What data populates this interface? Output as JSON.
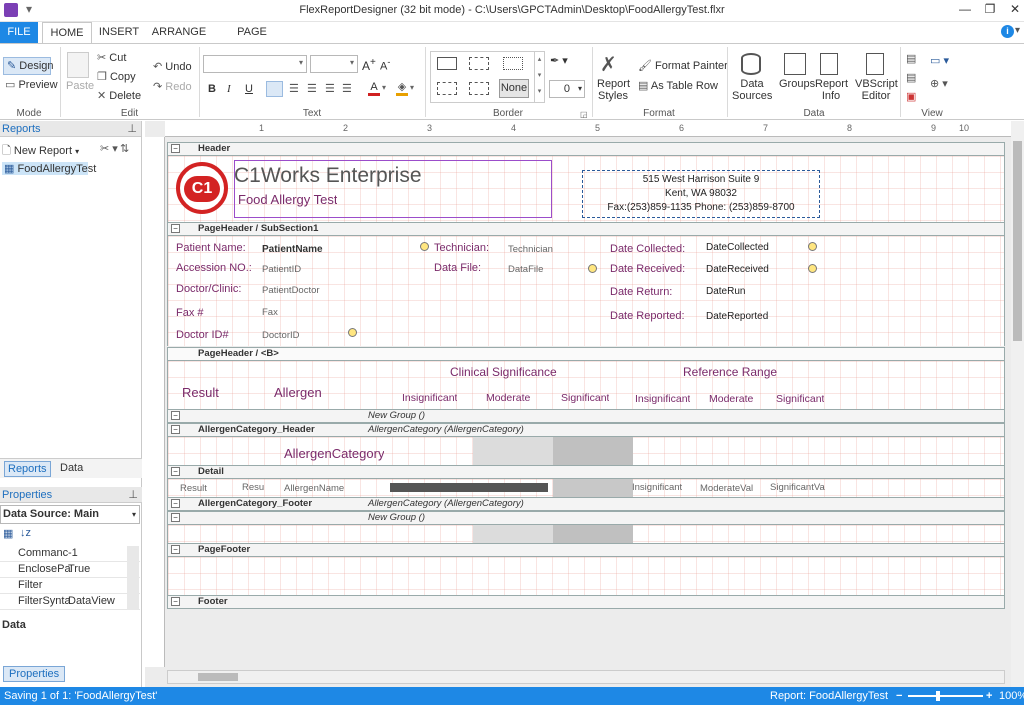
{
  "window": {
    "title": "FlexReportDesigner (32 bit mode) - C:\\Users\\GPCTAdmin\\Desktop\\FoodAllergyTest.flxr"
  },
  "tabs": [
    "FILE",
    "HOME",
    "INSERT",
    "ARRANGE",
    "PAGE SETUP"
  ],
  "ribbon": {
    "mode": {
      "design": "Design",
      "preview": "Preview",
      "label": "Mode"
    },
    "edit": {
      "paste": "Paste",
      "cut": "Cut",
      "copy": "Copy",
      "delete": "Delete",
      "undo": "Undo",
      "redo": "Redo",
      "label": "Edit"
    },
    "text": {
      "label": "Text"
    },
    "border": {
      "none": "None",
      "width": "0",
      "label": "Border"
    },
    "format": {
      "report_styles": "Report\nStyles",
      "format_painter": "Format Painter",
      "as_table_row": "As Table Row",
      "label": "Format"
    },
    "data": {
      "data_sources": "Data\nSources",
      "groups": "Groups",
      "report_info": "Report\nInfo",
      "vbscript": "VBScript\nEditor",
      "label": "Data"
    },
    "view": {
      "label": "View"
    }
  },
  "left": {
    "reports_title": "Reports",
    "new_report": "New Report",
    "report_item": "FoodAllergyTest",
    "tab_reports": "Reports",
    "tab_data": "Data",
    "properties_title": "Properties",
    "datasource": "Data Source: Main",
    "props": [
      {
        "k": "Commanc",
        "v": "-1"
      },
      {
        "k": "EnclosePa",
        "v": "True"
      },
      {
        "k": "Filter",
        "v": ""
      },
      {
        "k": "FilterSynta",
        "v": "DataView"
      }
    ],
    "desc": "Data",
    "tab_properties": "Properties"
  },
  "ruler": [
    "1",
    "2",
    "3",
    "4",
    "5",
    "6",
    "7",
    "8",
    "9",
    "10"
  ],
  "bands": {
    "header": "Header",
    "pageheader1": "PageHeader / SubSection1",
    "pageheader2": "PageHeader / <B>",
    "newgroup1": "New Group ()",
    "cat_header": "AllergenCategory_Header",
    "cat_header_sub": "AllergenCategory (AllergenCategory)",
    "detail": "Detail",
    "cat_footer": "AllergenCategory_Footer",
    "cat_footer_sub": "AllergenCategory (AllergenCategory)",
    "newgroup2": "New Group ()",
    "pagefooter": "PageFooter",
    "footer": "Footer"
  },
  "header": {
    "logo": "C1",
    "company": "C1Works Enterprise",
    "subtitle": "Food Allergy Test",
    "addr1": "515 West Harrison Suite 9",
    "addr2": "Kent, WA 98032",
    "addr3": "Fax:(253)859-1135 Phone: (253)859-8700"
  },
  "ph1": {
    "patient_name_lbl": "Patient Name:",
    "patient_name_fld": "PatientName",
    "accession_lbl": "Accession NO.:",
    "accession_fld": "PatientID",
    "doctor_lbl": "Doctor/Clinic:",
    "doctor_fld": "PatientDoctor",
    "fax_lbl": "Fax #",
    "fax_fld": "Fax",
    "doctorid_lbl": "Doctor ID#",
    "doctorid_fld": "DoctorID",
    "tech_lbl": "Technician:",
    "tech_fld": "Technician",
    "datafile_lbl": "Data File:",
    "datafile_fld": "DataFile",
    "collected_lbl": "Date Collected:",
    "collected_fld": "DateCollected",
    "received_lbl": "Date Received:",
    "received_fld": "DateReceived",
    "return_lbl": "Date Return:",
    "return_fld": "DateRun",
    "reported_lbl": "Date Reported:",
    "reported_fld": "DateReported"
  },
  "ph2": {
    "result": "Result",
    "allergen": "Allergen",
    "clinical": "Clinical Significance",
    "reference": "Reference Range",
    "insig1": "Insignificant",
    "mod1": "Moderate",
    "sig1": "Significant",
    "insig2": "Insignificant",
    "mod2": "Moderate",
    "sig2": "Significant"
  },
  "cathdr": {
    "field": "AllergenCategory"
  },
  "detail": {
    "result": "Result",
    "resu": "Resu",
    "allergen": "AllergenName",
    "insig": "Insignificant",
    "mod": "ModerateVal",
    "sig": "SignificantVa"
  },
  "status": {
    "left": "Saving 1 of 1: 'FoodAllergyTest'",
    "report": "Report: FoodAllergyTest",
    "zoom": "100%"
  }
}
